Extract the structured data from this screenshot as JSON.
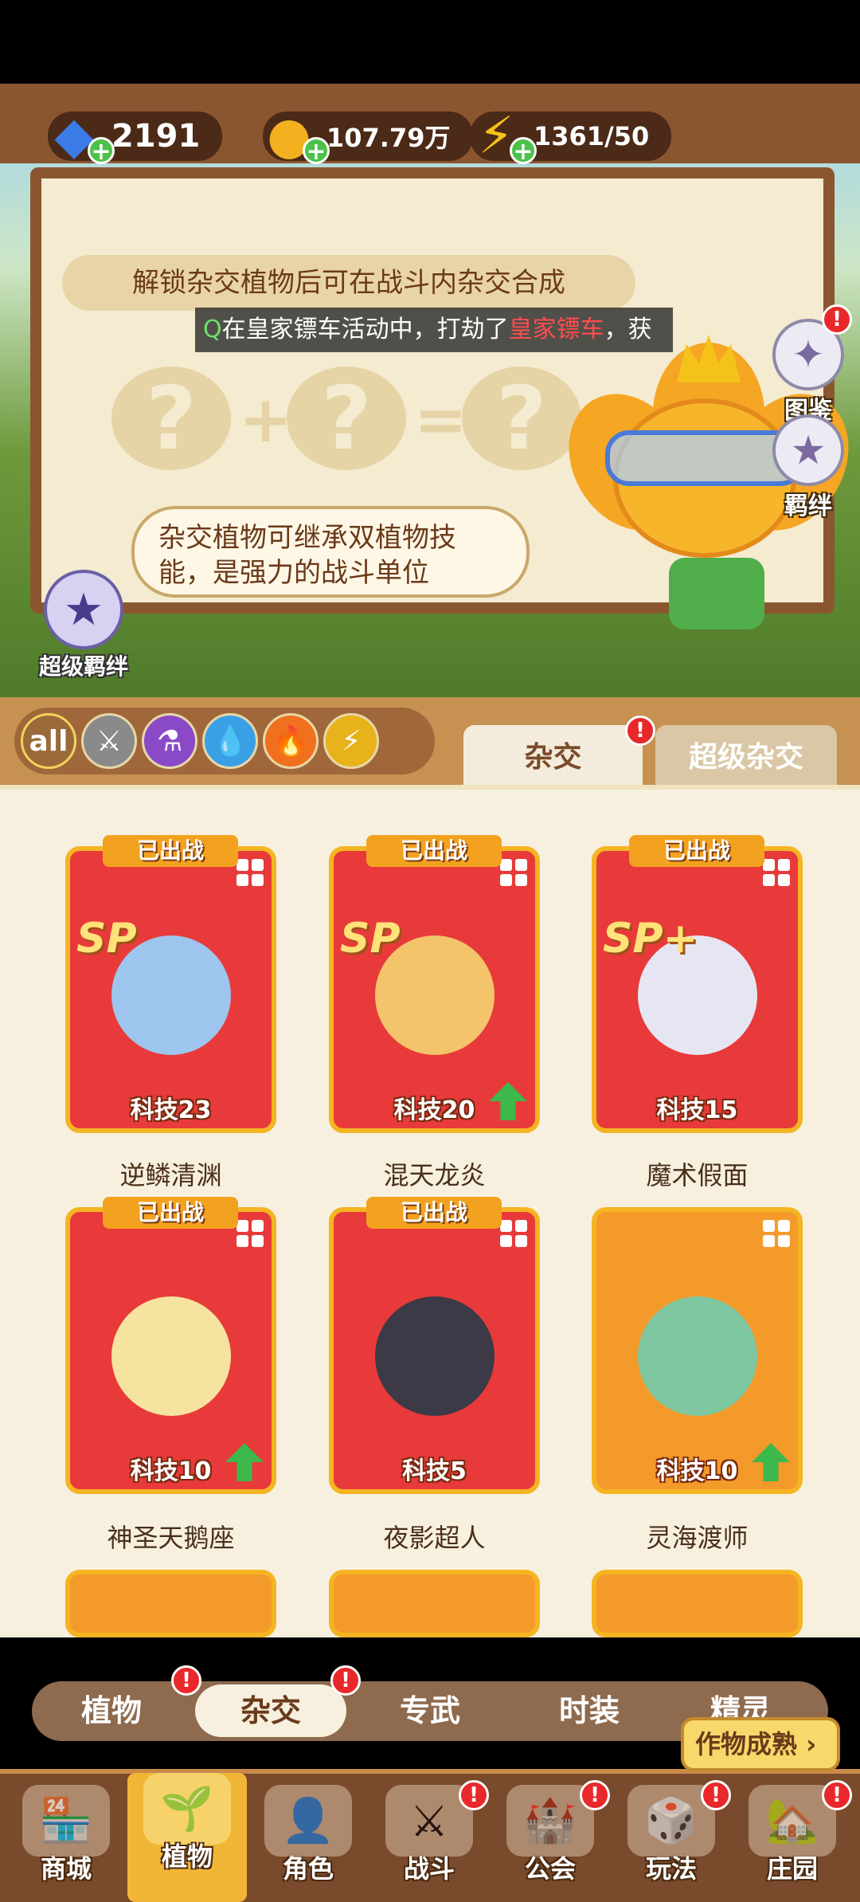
{
  "currency": {
    "gems": "2191",
    "coins": "107.79万",
    "energy": "1361/50",
    "icons": [
      "diamond-icon",
      "coin-icon",
      "lightning-icon"
    ]
  },
  "hybrid_intro": {
    "unlock_tip": "解锁杂交植物后可在战斗内杂交合成",
    "ticker_prefix": "Q",
    "ticker_text": "在皇家镖车活动中，打劫了",
    "ticker_highlight": "皇家镖车",
    "ticker_tail": "，获",
    "bubble_text": "杂交植物可继承双植物技能，是强力的战斗单位"
  },
  "side_buttons": {
    "codex_label": "图鉴",
    "bond_label": "羁绊",
    "super_bond_label": "超级羁绊",
    "reddot": "!"
  },
  "filters": {
    "all_label": "all",
    "chips": [
      "all",
      "sword-icon",
      "potion-icon",
      "water-icon",
      "fire-icon",
      "lightning-icon"
    ]
  },
  "tabs": {
    "hybrid": "杂交",
    "super_hybrid": "超级杂交"
  },
  "cards": [
    {
      "name": "逆鳞清渊",
      "level": "科技23",
      "badge": "已出战",
      "sp": "SP",
      "upgrade": false,
      "color": "#e83a3a",
      "face": "#9ec5ee"
    },
    {
      "name": "混天龙炎",
      "level": "科技20",
      "badge": "已出战",
      "sp": "SP",
      "upgrade": true,
      "color": "#e83a3a",
      "face": "#f3c46a"
    },
    {
      "name": "魔术假面",
      "level": "科技15",
      "badge": "已出战",
      "sp": "SP+",
      "upgrade": false,
      "color": "#e83a3a",
      "face": "#e6e6f2"
    },
    {
      "name": "神圣天鹅座",
      "level": "科技10",
      "badge": "已出战",
      "sp": "",
      "upgrade": true,
      "color": "#e83a3a",
      "face": "#f7e3a0"
    },
    {
      "name": "夜影超人",
      "level": "科技5",
      "badge": "已出战",
      "sp": "",
      "upgrade": false,
      "color": "#e83a3a",
      "face": "#3b3a46"
    },
    {
      "name": "灵海渡师",
      "level": "科技10",
      "badge": "",
      "sp": "",
      "upgrade": true,
      "color": "#f39a2a",
      "face": "#7fc7a0"
    }
  ],
  "subtabs": [
    "植物",
    "杂交",
    "专武",
    "时装",
    "精灵"
  ],
  "harvest_label": "作物成熟",
  "nav": [
    "商城",
    "植物",
    "角色",
    "战斗",
    "公会",
    "玩法",
    "庄园"
  ]
}
